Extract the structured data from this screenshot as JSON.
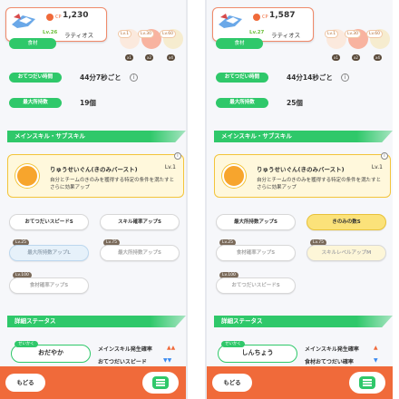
{
  "panels": [
    {
      "card": {
        "cp_label": "CP",
        "cp": "1,230",
        "level": "Lv.26",
        "name": "ラティオス"
      },
      "bad_tag": "食材",
      "ingredients": [
        {
          "lv": "Lv.1",
          "count": "x1"
        },
        {
          "lv": "Lv.30",
          "count": "x2"
        },
        {
          "lv": "Lv.60",
          "count": "x4"
        }
      ],
      "help_time_tag": "おてつだい時間",
      "help_time": "44分7秒ごと",
      "info_glyph": "i",
      "max_carry_tag": "最大所持数",
      "max_carry": "19個",
      "skills_header": "メインスキル・サブスキル",
      "skill": {
        "name": "りゅうせいぐん(きのみバースト)",
        "level": "Lv.1",
        "desc": "自分とチームのきのみを獲得する特定の条件を満たすとさらに効果アップ"
      },
      "subskills": [
        {
          "lv": "",
          "label": "おてつだいスピードS"
        },
        {
          "lv": "",
          "label": "スキル確率アップS"
        },
        {
          "lv": "Lv.25",
          "label": "最大所持数アップL"
        },
        {
          "lv": "Lv.75",
          "label": "最大所持数アップS"
        },
        {
          "lv": "Lv.100",
          "label": "食材確率アップS"
        }
      ],
      "status_header": "詳細ステータス",
      "nature_tag": "せいかく",
      "nature": "おだやか",
      "nat_up": "メインスキル発生確率",
      "nat_down": "おてつだいスピード",
      "back": "もどる"
    },
    {
      "card": {
        "cp_label": "CP",
        "cp": "1,587",
        "level": "Lv.27",
        "name": "ラティオス"
      },
      "bad_tag": "食材",
      "ingredients": [
        {
          "lv": "Lv.1",
          "count": "x1"
        },
        {
          "lv": "Lv.30",
          "count": "x2"
        },
        {
          "lv": "Lv.60",
          "count": "x4"
        }
      ],
      "help_time_tag": "おてつだい時間",
      "help_time": "44分14秒ごと",
      "info_glyph": "i",
      "max_carry_tag": "最大所持数",
      "max_carry": "25個",
      "skills_header": "メインスキル・サブスキル",
      "skill": {
        "name": "りゅうせいぐん(きのみバースト)",
        "level": "Lv.1",
        "desc": "自分とチームのきのみを獲得する特定の条件を満たすとさらに効果アップ"
      },
      "subskills": [
        {
          "lv": "",
          "label": "最大所持数アップS"
        },
        {
          "lv": "",
          "label": "きのみの数S"
        },
        {
          "lv": "Lv.25",
          "label": "食材確率アップS"
        },
        {
          "lv": "Lv.75",
          "label": "スキルレベルアップM"
        },
        {
          "lv": "Lv.100",
          "label": "おてつだいスピードS"
        }
      ],
      "status_header": "詳細ステータス",
      "nature_tag": "せいかく",
      "nature": "しんちょう",
      "nat_up": "メインスキル発生確率",
      "nat_down": "食材おてつだい確率",
      "back": "もどる"
    }
  ],
  "colors": {
    "accent_green": "#2fc86a",
    "bar_orange": "#f06a3a",
    "skill_gold": "#f3c43a"
  }
}
